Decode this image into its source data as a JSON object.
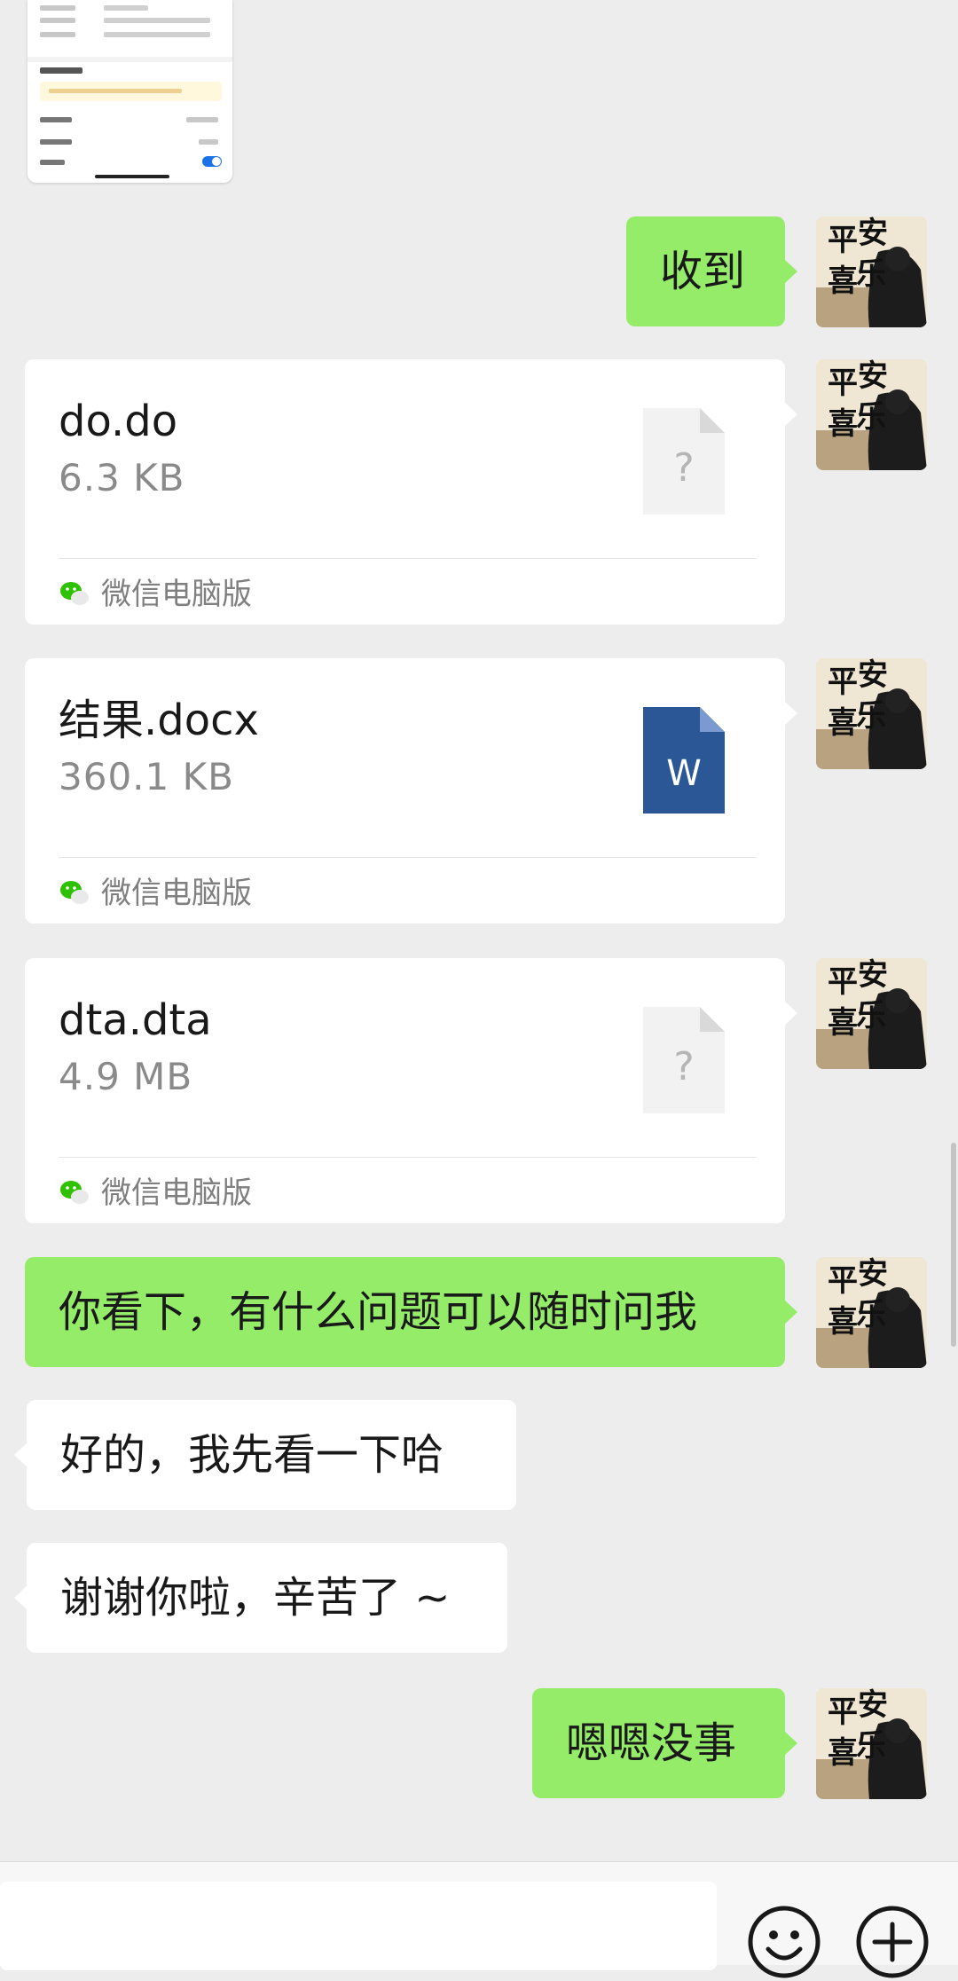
{
  "chat": {
    "messages": [
      {
        "type": "image",
        "from": "other",
        "description_icon": "screenshot-thumbnail"
      },
      {
        "type": "text",
        "from": "me",
        "text": "收到"
      },
      {
        "type": "file",
        "from": "me",
        "name": "do.do",
        "size": "6.3  KB",
        "source": "微信电脑版",
        "icon": "unknown-file-icon"
      },
      {
        "type": "file",
        "from": "me",
        "name": "结果.docx",
        "size": "360.1  KB",
        "source": "微信电脑版",
        "icon": "word-file-icon",
        "icon_letter": "W"
      },
      {
        "type": "file",
        "from": "me",
        "name": "dta.dta",
        "size": "4.9  MB",
        "source": "微信电脑版",
        "icon": "unknown-file-icon"
      },
      {
        "type": "text",
        "from": "me",
        "text": "你看下，有什么问题可以随时问我"
      },
      {
        "type": "text",
        "from": "other",
        "text": "好的，我先看一下哈"
      },
      {
        "type": "text",
        "from": "other",
        "text": "谢谢你啦，辛苦了 ~"
      },
      {
        "type": "text",
        "from": "me",
        "text": "嗯嗯没事"
      }
    ],
    "unknown_file_glyph": "?",
    "avatar_text": "平安喜乐"
  },
  "input_bar": {
    "placeholder": "",
    "emoji_icon": "emoji-icon",
    "plus_icon": "plus-icon"
  },
  "colors": {
    "background": "#ededed",
    "my_bubble": "#95ec69",
    "other_bubble": "#ffffff",
    "word_blue": "#2b5797"
  }
}
